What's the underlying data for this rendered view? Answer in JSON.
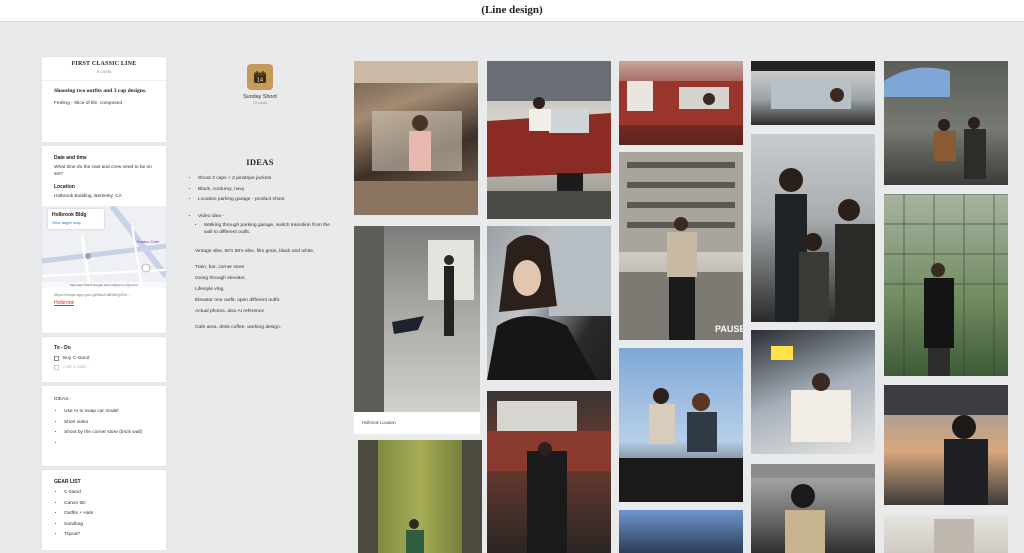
{
  "header": {
    "title": "(Line design)"
  },
  "left_card": {
    "title": "FIRST CLASSIC LINE",
    "subtitle": "8 cards",
    "intro_heading": "Shooting two outfits and 3 cap designs.",
    "intro_text": "Feeling - Slice of life, composed"
  },
  "date_card": {
    "heading": "Date and time",
    "question": "What time do the cast and crew need to be on set?",
    "location_heading": "Location",
    "location_value": "Holbrook Building, Berkeley, CA",
    "map_title": "Holbrook Bldg",
    "map_link": "View larger map",
    "map_footer": "Map data ©2024 Google   Terms   Report a map error",
    "map_pin_label": "Easton Cafe",
    "url": "https://maps.app.goo.gl/MscKaBd9Uj4Sn...",
    "url_label": "Holbrook"
  },
  "todo": {
    "heading": "To - Do",
    "items": [
      {
        "label": "Buy C-stand"
      },
      {
        "label": "Add a task..."
      }
    ]
  },
  "ideas_card": {
    "heading": "IDEAS:",
    "items": [
      {
        "label": "Use AI to swap car model"
      },
      {
        "label": "Short video"
      },
      {
        "label": "Shoot by the corner store (brick wall)"
      },
      {
        "label": ""
      }
    ]
  },
  "gear": {
    "heading": "GEAR LIST",
    "items": [
      {
        "label": "C-stand"
      },
      {
        "label": "Canon 5D"
      },
      {
        "label": "Outfits + Hats"
      },
      {
        "label": "Sandbag"
      },
      {
        "label": "Tripod?"
      }
    ]
  },
  "board": {
    "icon_text": "14",
    "name": "Sunday Shoot",
    "subtitle": "15 cards"
  },
  "ideas_doc": {
    "title": "IDEAS",
    "bullets": [
      {
        "label": "Shoot 3 caps + 2 pinstripe jackets"
      },
      {
        "label": "Black, corduroy, navy"
      },
      {
        "label": "Location parking garage - product shoot"
      }
    ],
    "video_label": "Video idea -",
    "video_sub": "Walking through parking garage, switch transition from the wall to different outfit.",
    "lines": [
      {
        "label": "Vintage vibe, 90's 80's vibe, film grain, black and white,"
      },
      {
        "label": "Train, bar, corner store"
      },
      {
        "label": "Going through elevator,"
      },
      {
        "label": "Lifestyle vlog,"
      },
      {
        "label": "Elevator one outfit, open different outfit."
      },
      {
        "label": "Actual photos, also AI reference"
      },
      {
        "label": "Cafe area, drink coffee, working design."
      }
    ]
  },
  "photos": {
    "caption_holbrook": "Holbrook Location",
    "pause_text": "PAUSE"
  }
}
